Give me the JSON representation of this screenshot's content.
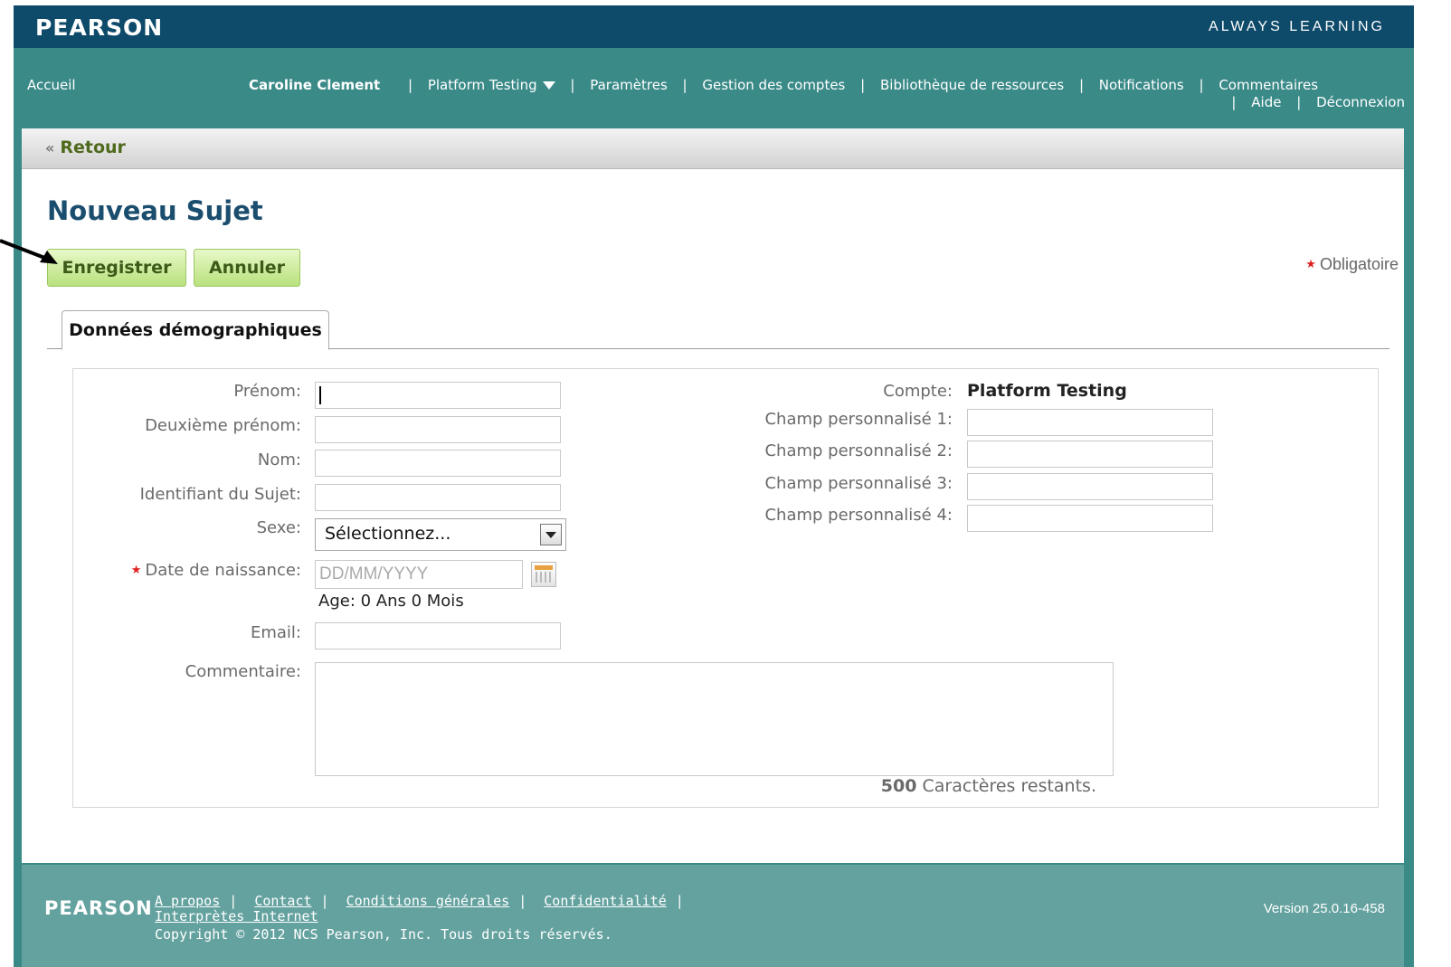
{
  "header": {
    "logo": "PEARSON",
    "tagline": "ALWAYS LEARNING"
  },
  "nav": {
    "home": "Accueil",
    "user": "Caroline Clement",
    "links": [
      "Platform Testing",
      "Paramètres",
      "Gestion des comptes",
      "Bibliothèque de ressources",
      "Notifications",
      "Commentaires"
    ],
    "links_line2": [
      "Aide",
      "Déconnexion"
    ],
    "separator": "|"
  },
  "back_label": "Retour",
  "page_title": "Nouveau Sujet",
  "buttons": {
    "save": "Enregistrer",
    "cancel": "Annuler"
  },
  "required_legend": "Obligatoire",
  "tab_label": "Données démographiques",
  "form": {
    "first_name_label": "Prénom:",
    "middle_name_label": "Deuxième prénom:",
    "last_name_label": "Nom:",
    "subject_id_label": "Identifiant du Sujet:",
    "gender_label": "Sexe:",
    "gender_value": "Sélectionnez...",
    "dob_label": "Date de naissance:",
    "dob_placeholder": "DD/MM/YYYY",
    "age_text": "Age: 0 Ans 0 Mois",
    "email_label": "Email:",
    "comment_label": "Commentaire:",
    "chars_count": "500",
    "chars_text": " Caractères restants.",
    "account_label": "Compte:",
    "account_value": "Platform Testing",
    "custom1_label": "Champ personnalisé 1:",
    "custom2_label": "Champ personnalisé 2:",
    "custom3_label": "Champ personnalisé 3:",
    "custom4_label": "Champ personnalisé 4:"
  },
  "footer": {
    "logo": "PEARSON",
    "links": [
      "A propos",
      "Contact",
      "Conditions générales",
      "Confidentialité"
    ],
    "link_line2": "Interprètes Internet",
    "separator": "|",
    "copyright": "Copyright © 2012 NCS Pearson, Inc. Tous droits réservés.",
    "version": "Version 25.0.16-458"
  },
  "colors": {
    "header_bg": "#0e4a6a",
    "nav_bg": "#3a8a88",
    "title": "#1b4e6e",
    "button_bg": "#c8ea8e",
    "required": "#e02020"
  }
}
